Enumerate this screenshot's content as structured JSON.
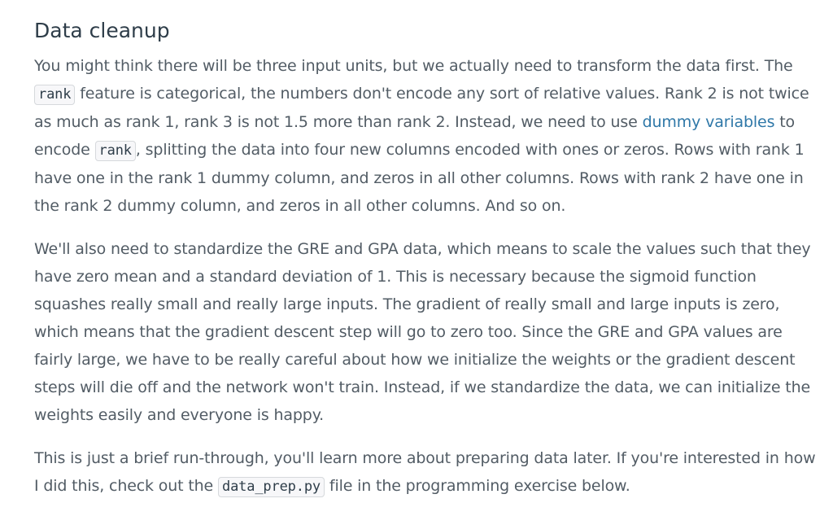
{
  "heading": "Data cleanup",
  "p1": {
    "t1": "You might think there will be three input units, but we actually need to transform the data first. The ",
    "code1": "rank",
    "t2": " feature is categorical, the numbers don't encode any sort of relative values. Rank 2 is not twice as much as rank 1, rank 3 is not 1.5 more than rank 2. Instead, we need to use ",
    "link": "dummy variables",
    "t3": " to encode ",
    "code2": "rank",
    "t4": ", splitting the data into four new columns encoded with ones or zeros. Rows with rank 1 have one in the rank 1 dummy column, and zeros in all other columns. Rows with rank 2 have one in the rank 2 dummy column, and zeros in all other columns. And so on."
  },
  "p2": "We'll also need to standardize the GRE and GPA data, which means to scale the values such that they have zero mean and a standard deviation of 1. This is necessary because the sigmoid function squashes really small and really large inputs. The gradient of really small and large inputs is zero, which means that the gradient descent step will go to zero too. Since the GRE and GPA values are fairly large, we have to be really careful about how we initialize the weights or the gradient descent steps will die off and the network won't train. Instead, if we standardize the data, we can initialize the weights easily and everyone is happy.",
  "p3": {
    "t1": "This is just a brief run-through, you'll learn more about preparing data later. If you're interested in how I did this, check out the ",
    "code": "data_prep.py",
    "t2": " file in the programming exercise below."
  },
  "colors": {
    "text": "#525c65",
    "heading": "#2e3d49",
    "link": "#2f78a8",
    "code_bg": "#f7f7f9",
    "code_border": "#d6d9dc"
  }
}
